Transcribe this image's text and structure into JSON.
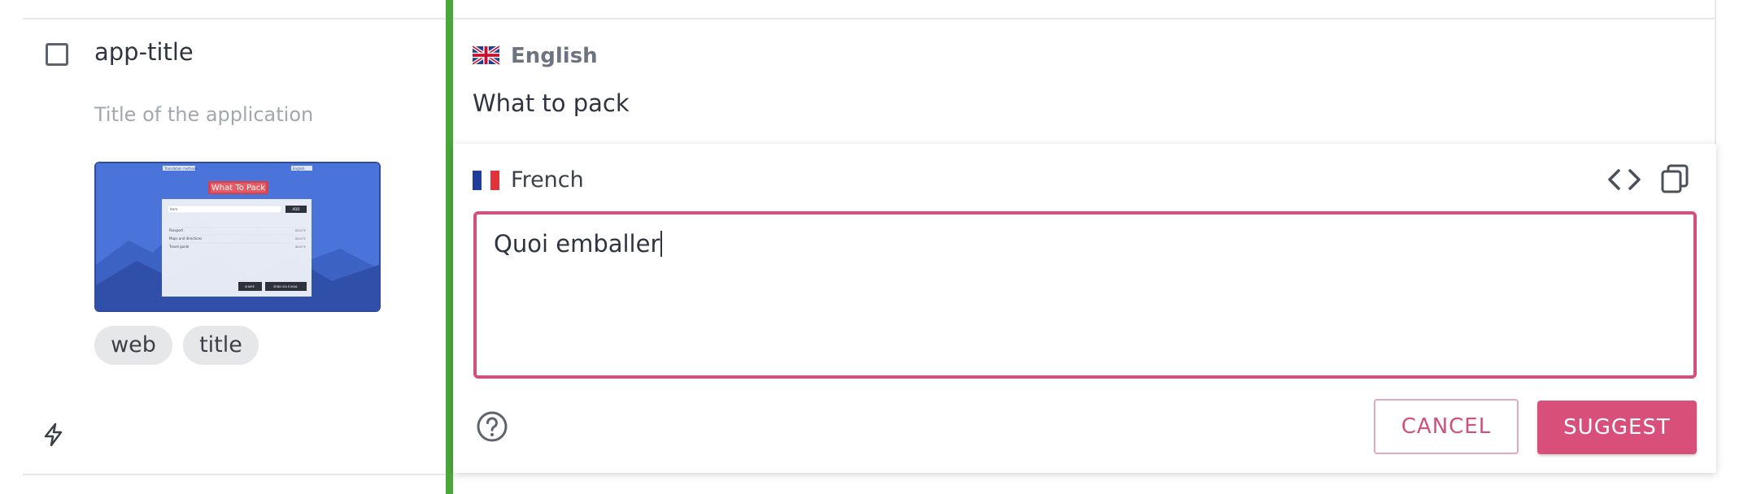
{
  "key": {
    "name": "app-title",
    "description": "Title of the application",
    "tags": [
      "web",
      "title"
    ],
    "screenshot": {
      "highlighted_text": "What To Pack",
      "header_left": "Translation methods",
      "header_right": "English",
      "input_placeholder": "Item",
      "add_label": "ADD",
      "list_items": [
        {
          "label": "Passport",
          "action": "DELETE"
        },
        {
          "label": "Maps and directions",
          "action": "DELETE"
        },
        {
          "label": "Travel guide",
          "action": "DELETE"
        }
      ],
      "share_label": "SHARE",
      "email_label": "SEND VIA E-MAIL"
    }
  },
  "base_translation": {
    "language": "English",
    "flag": "gb-flag",
    "text": "What to pack"
  },
  "editor": {
    "language": "French",
    "flag": "fr-flag",
    "value": "Quoi emballer",
    "cancel_label": "CANCEL",
    "suggest_label": "SUGGEST"
  },
  "colors": {
    "accent": "#d84f7a",
    "state_bar": "#4aa83a",
    "screenshot_bg": "#4a74d9"
  },
  "icons": [
    "checkbox-icon",
    "lightning-bolt-icon",
    "code-icon",
    "copy-icon",
    "help-icon"
  ]
}
